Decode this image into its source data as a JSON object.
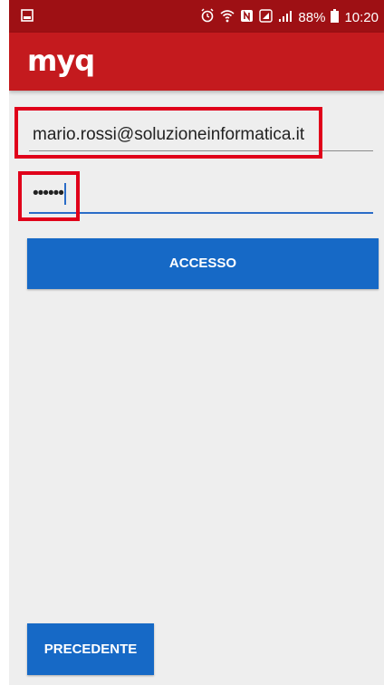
{
  "status_bar": {
    "notification_icon": "notification-icon",
    "battery_percent": "88%",
    "time": "10:20"
  },
  "app": {
    "logo_text": "myq"
  },
  "login_form": {
    "username_value": "mario.rossi@soluzioneinformatica.it",
    "password_value": "••••••",
    "login_button_label": "ACCESSO"
  },
  "footer": {
    "back_button_label": "PRECEDENTE"
  },
  "colors": {
    "status_bar": "#9e1014",
    "app_bar": "#c41a1e",
    "button": "#1669c6",
    "highlight": "#e0001a",
    "focus_line": "#2a6cc7"
  }
}
